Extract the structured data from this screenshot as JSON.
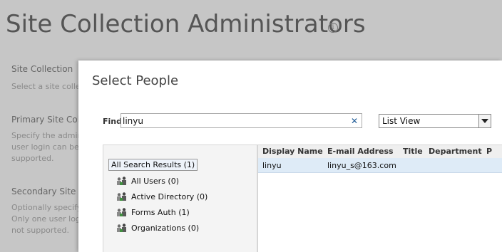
{
  "background_page": {
    "title": "Site Collection Administrators",
    "info_icon": "info-circle-icon",
    "sections": [
      {
        "heading": "Site Collection",
        "description_lines": [
          "Select a site collec"
        ]
      },
      {
        "heading": "Primary Site Colle",
        "description_lines": [
          "Specify the admin",
          "user login can be p",
          "supported."
        ]
      },
      {
        "heading": "Secondary Site C",
        "description_lines": [
          "Optionally specify",
          "Only one user logi",
          "not supported."
        ]
      }
    ]
  },
  "dialog": {
    "title": "Select People",
    "find": {
      "label": "Find",
      "value": "linyu",
      "clear_icon": "close-x-icon"
    },
    "view_select": {
      "selected": "List View"
    },
    "tree": {
      "root": "All Search Results (1)",
      "items": [
        {
          "label": "All Users (0)",
          "icon": "users-group-icon"
        },
        {
          "label": "Active Directory (0)",
          "icon": "users-group-icon"
        },
        {
          "label": "Forms Auth (1)",
          "icon": "users-group-icon"
        },
        {
          "label": "Organizations (0)",
          "icon": "users-group-icon"
        }
      ]
    },
    "grid": {
      "columns": [
        "Display Name",
        "E-mail Address",
        "Title",
        "Department",
        "P"
      ],
      "rows": [
        {
          "display_name": "linyu",
          "email": "linyu_s@163.com",
          "title": "",
          "department": ""
        }
      ]
    }
  }
}
